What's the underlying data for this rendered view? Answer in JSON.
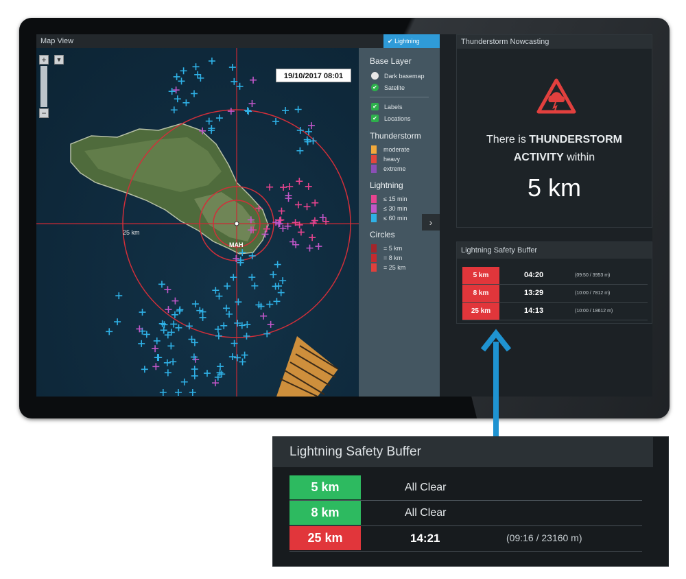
{
  "map": {
    "title": "Map View",
    "timestamp": "19/10/2017 08:01",
    "lightning_toggle": "Lightning",
    "scale_label": "25 km",
    "city_label": "MAH",
    "zoom_in": "+",
    "zoom_out": "−"
  },
  "legend": {
    "base_layer": {
      "title": "Base Layer",
      "items": [
        {
          "label": "Dark basemap",
          "selected": false
        },
        {
          "label": "Satelite",
          "selected": true
        }
      ],
      "overlays": [
        {
          "label": "Labels",
          "checked": true
        },
        {
          "label": "Locations",
          "checked": true
        }
      ]
    },
    "thunderstorm": {
      "title": "Thunderstorm",
      "items": [
        {
          "label": "moderate",
          "color": "#f2a93b"
        },
        {
          "label": "heavy",
          "color": "#e4463c"
        },
        {
          "label": "extreme",
          "color": "#8a4fb5"
        }
      ]
    },
    "lightning": {
      "title": "Lightning",
      "items": [
        {
          "label": "≤ 15 min",
          "color": "#e8448f"
        },
        {
          "label": "≤ 30 min",
          "color": "#c257c9"
        },
        {
          "label": "≤ 60 min",
          "color": "#2fb1e6"
        }
      ]
    },
    "circles": {
      "title": "Circles",
      "items": [
        {
          "label": "=  5 km",
          "color": "#a3262b"
        },
        {
          "label": "=  8 km",
          "color": "#c52a2e"
        },
        {
          "label": "= 25 km",
          "color": "#e0403c"
        }
      ]
    }
  },
  "nowcasting": {
    "title": "Thunderstorm Nowcasting",
    "line1_prefix": "There is",
    "line1_bold": "THUNDERSTORM",
    "line2_bold": "ACTIVITY",
    "line2_suffix": "within",
    "distance": "5 km"
  },
  "buffer": {
    "title": "Lightning Safety Buffer",
    "rows": [
      {
        "distance": "5 km",
        "time": "04:20",
        "detail": "(09:50 / 3953 m)",
        "color": "#e1363b"
      },
      {
        "distance": "8 km",
        "time": "13:29",
        "detail": "(10:00 / 7812 m)",
        "color": "#e1363b"
      },
      {
        "distance": "25 km",
        "time": "14:13",
        "detail": "(10:00 / 18612 m)",
        "color": "#e1363b"
      }
    ]
  },
  "inset": {
    "title": "Lightning Safety Buffer",
    "rows": [
      {
        "distance": "5 km",
        "status": "All Clear",
        "color": "#2dba60"
      },
      {
        "distance": "8 km",
        "status": "All Clear",
        "color": "#2dba60"
      },
      {
        "distance": "25 km",
        "time": "14:21",
        "detail": "(09:16 / 23160 m)",
        "color": "#e1363b"
      }
    ]
  },
  "colors": {
    "accent_blue": "#2f9bd8",
    "alert_red": "#e1363b",
    "clear_green": "#2dba60"
  },
  "icons": {
    "warning": "thunderstorm-warning-triangle-icon",
    "arrow": "up-arrow-icon"
  }
}
